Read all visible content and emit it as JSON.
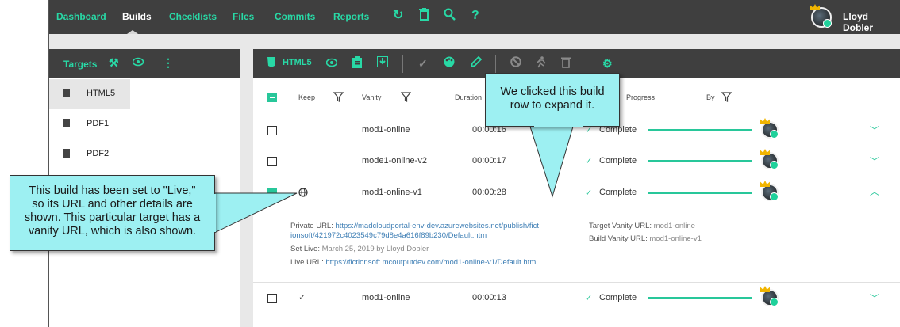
{
  "nav": {
    "items": [
      "Dashboard",
      "Builds",
      "Checklists",
      "Files",
      "Commits",
      "Reports"
    ],
    "active": "Builds",
    "icons": [
      "refresh-icon",
      "trash-icon",
      "search-icon",
      "help-icon"
    ],
    "user_name": "Lloyd Dobler"
  },
  "targets": {
    "header": "Targets",
    "header_icons": [
      "hammer-icon",
      "eye-icon",
      "more-icon"
    ],
    "items": [
      {
        "label": "HTML5",
        "selected": true
      },
      {
        "label": "PDF1",
        "selected": false
      },
      {
        "label": "PDF2",
        "selected": false
      }
    ]
  },
  "builds": {
    "target_label": "HTML5",
    "toolbar_icons": [
      "eye-icon",
      "clipboard-icon",
      "download-icon",
      "check-icon",
      "palette-icon",
      "pen-icon",
      "cancel-icon",
      "run-icon",
      "trash-icon",
      "settings-icon"
    ],
    "columns": {
      "keep": "Keep",
      "vanity": "Vanity",
      "duration": "Duration",
      "progress": "Progress",
      "by": "By"
    },
    "rows": [
      {
        "vanity": "mod1-online",
        "duration": "00:00:16",
        "status": "Complete",
        "progress": 1.0,
        "keep": "",
        "checked": false,
        "expanded": false
      },
      {
        "vanity": "mode1-online-v2",
        "duration": "00:00:17",
        "status": "Complete",
        "progress": 1.0,
        "keep": "",
        "checked": false,
        "expanded": false
      },
      {
        "vanity": "mod1-online-v1",
        "duration": "00:00:28",
        "status": "Complete",
        "progress": 1.0,
        "keep": "globe",
        "checked": true,
        "expanded": true
      },
      {
        "vanity": "mod1-online",
        "duration": "00:00:13",
        "status": "Complete",
        "progress": 1.0,
        "keep": "check",
        "checked": false,
        "expanded": false
      }
    ],
    "detail": {
      "private_url_label": "Private URL:",
      "private_url_line1": "https://madcloudportal-env-dev.azurewebsites.net/publish/fict",
      "private_url_line2": "ionsoft/421972c4023549c79d8e4a616f89b230/Default.htm",
      "set_live_label": "Set Live:",
      "set_live_value": "March 25, 2019 by Lloyd Dobler",
      "live_url_label": "Live URL:",
      "live_url_value": "https://fictionsoft.mcoutputdev.com/mod1-online-v1/Default.htm",
      "target_vanity_label": "Target Vanity URL:",
      "target_vanity_value": "mod1-online",
      "build_vanity_label": "Build Vanity URL:",
      "build_vanity_value": "mod1-online-v1"
    }
  },
  "callouts": {
    "top_line1": "We clicked this build",
    "top_line2": "row to expand it.",
    "left_line1": "This build has been set to \"Live,\"",
    "left_line2": "so its URL and other details are",
    "left_line3": "shown. This particular target has a",
    "left_line4": "vanity URL, which is also shown."
  },
  "colors": {
    "accent": "#28d9a6",
    "header_bg": "#3f3f3f",
    "callout_bg": "#9df0f2"
  }
}
